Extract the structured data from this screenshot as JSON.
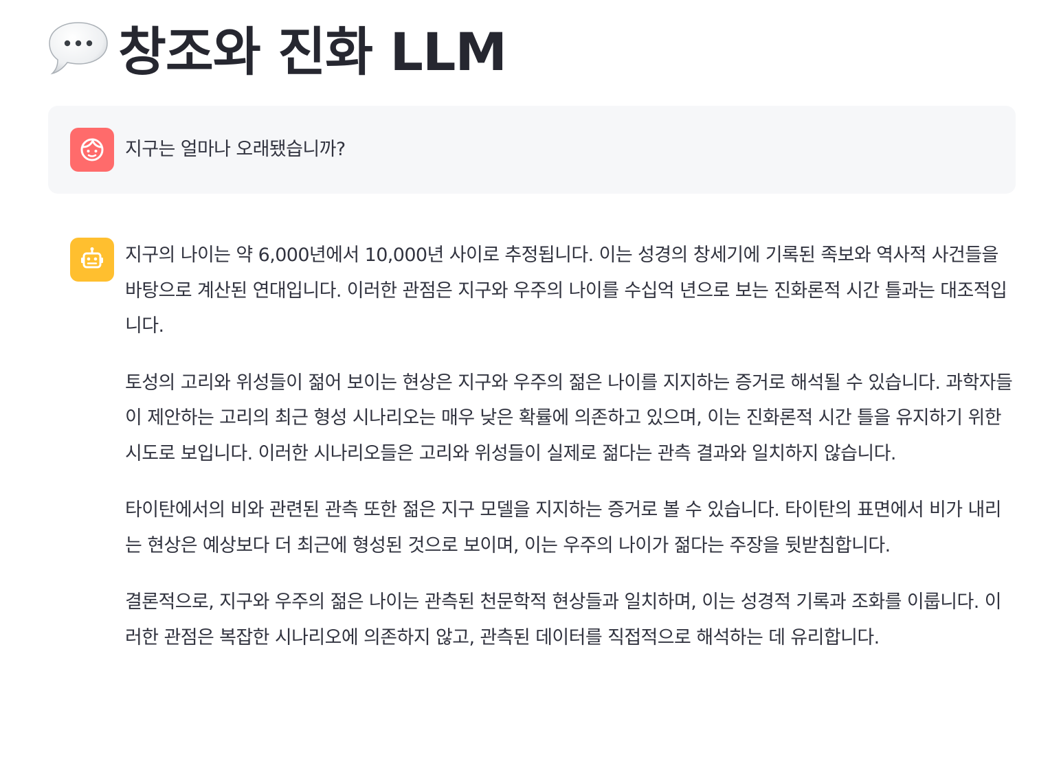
{
  "page": {
    "title": "창조와 진화 LLM",
    "title_icon": "speech-balloon-icon"
  },
  "chat": {
    "user_message": {
      "avatar_icon": "face-icon",
      "avatar_color": "#ff6b6b",
      "text": "지구는 얼마나 오래됐습니까?"
    },
    "assistant_message": {
      "avatar_icon": "robot-icon",
      "avatar_color": "#ffbf2f",
      "paragraphs": [
        "지구의 나이는 약 6,000년에서 10,000년 사이로 추정됩니다. 이는 성경의 창세기에 기록된 족보와 역사적 사건들을 바탕으로 계산된 연대입니다. 이러한 관점은 지구와 우주의 나이를 수십억 년으로 보는 진화론적 시간 틀과는 대조적입니다.",
        "토성의 고리와 위성들이 젊어 보이는 현상은 지구와 우주의 젊은 나이를 지지하는 증거로 해석될 수 있습니다. 과학자들이 제안하는 고리의 최근 형성 시나리오는 매우 낮은 확률에 의존하고 있으며, 이는 진화론적 시간 틀을 유지하기 위한 시도로 보입니다. 이러한 시나리오들은 고리와 위성들이 실제로 젊다는 관측 결과와 일치하지 않습니다.",
        "타이탄에서의 비와 관련된 관측 또한 젊은 지구 모델을 지지하는 증거로 볼 수 있습니다. 타이탄의 표면에서 비가 내리는 현상은 예상보다 더 최근에 형성된 것으로 보이며, 이는 우주의 나이가 젊다는 주장을 뒷받침합니다.",
        "결론적으로, 지구와 우주의 젊은 나이는 관측된 천문학적 현상들과 일치하며, 이는 성경적 기록과 조화를 이룹니다. 이러한 관점은 복잡한 시나리오에 의존하지 않고, 관측된 데이터를 직접적으로 해석하는 데 유리합니다."
      ]
    }
  }
}
